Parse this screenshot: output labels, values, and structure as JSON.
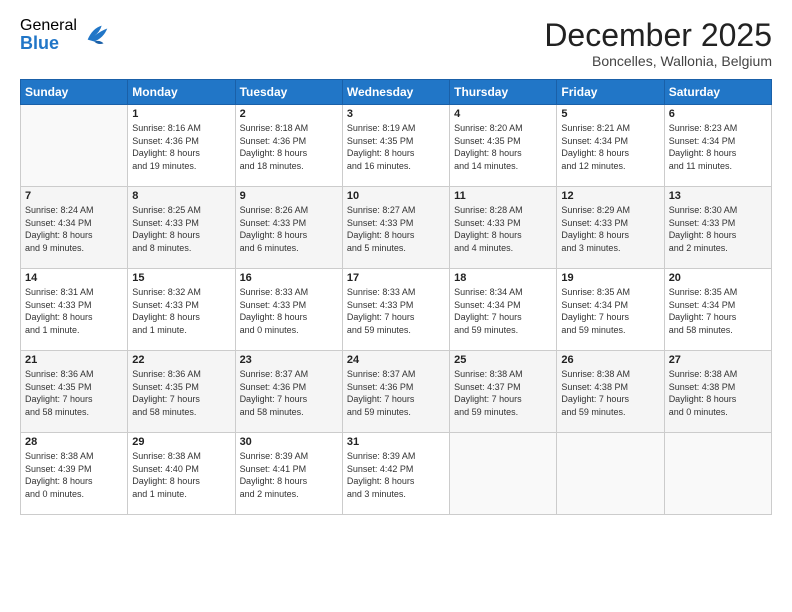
{
  "logo": {
    "general": "General",
    "blue": "Blue"
  },
  "header": {
    "month": "December 2025",
    "location": "Boncelles, Wallonia, Belgium"
  },
  "weekdays": [
    "Sunday",
    "Monday",
    "Tuesday",
    "Wednesday",
    "Thursday",
    "Friday",
    "Saturday"
  ],
  "weeks": [
    [
      {
        "day": "",
        "info": ""
      },
      {
        "day": "1",
        "info": "Sunrise: 8:16 AM\nSunset: 4:36 PM\nDaylight: 8 hours\nand 19 minutes."
      },
      {
        "day": "2",
        "info": "Sunrise: 8:18 AM\nSunset: 4:36 PM\nDaylight: 8 hours\nand 18 minutes."
      },
      {
        "day": "3",
        "info": "Sunrise: 8:19 AM\nSunset: 4:35 PM\nDaylight: 8 hours\nand 16 minutes."
      },
      {
        "day": "4",
        "info": "Sunrise: 8:20 AM\nSunset: 4:35 PM\nDaylight: 8 hours\nand 14 minutes."
      },
      {
        "day": "5",
        "info": "Sunrise: 8:21 AM\nSunset: 4:34 PM\nDaylight: 8 hours\nand 12 minutes."
      },
      {
        "day": "6",
        "info": "Sunrise: 8:23 AM\nSunset: 4:34 PM\nDaylight: 8 hours\nand 11 minutes."
      }
    ],
    [
      {
        "day": "7",
        "info": "Sunrise: 8:24 AM\nSunset: 4:34 PM\nDaylight: 8 hours\nand 9 minutes."
      },
      {
        "day": "8",
        "info": "Sunrise: 8:25 AM\nSunset: 4:33 PM\nDaylight: 8 hours\nand 8 minutes."
      },
      {
        "day": "9",
        "info": "Sunrise: 8:26 AM\nSunset: 4:33 PM\nDaylight: 8 hours\nand 6 minutes."
      },
      {
        "day": "10",
        "info": "Sunrise: 8:27 AM\nSunset: 4:33 PM\nDaylight: 8 hours\nand 5 minutes."
      },
      {
        "day": "11",
        "info": "Sunrise: 8:28 AM\nSunset: 4:33 PM\nDaylight: 8 hours\nand 4 minutes."
      },
      {
        "day": "12",
        "info": "Sunrise: 8:29 AM\nSunset: 4:33 PM\nDaylight: 8 hours\nand 3 minutes."
      },
      {
        "day": "13",
        "info": "Sunrise: 8:30 AM\nSunset: 4:33 PM\nDaylight: 8 hours\nand 2 minutes."
      }
    ],
    [
      {
        "day": "14",
        "info": "Sunrise: 8:31 AM\nSunset: 4:33 PM\nDaylight: 8 hours\nand 1 minute."
      },
      {
        "day": "15",
        "info": "Sunrise: 8:32 AM\nSunset: 4:33 PM\nDaylight: 8 hours\nand 1 minute."
      },
      {
        "day": "16",
        "info": "Sunrise: 8:33 AM\nSunset: 4:33 PM\nDaylight: 8 hours\nand 0 minutes."
      },
      {
        "day": "17",
        "info": "Sunrise: 8:33 AM\nSunset: 4:33 PM\nDaylight: 7 hours\nand 59 minutes."
      },
      {
        "day": "18",
        "info": "Sunrise: 8:34 AM\nSunset: 4:34 PM\nDaylight: 7 hours\nand 59 minutes."
      },
      {
        "day": "19",
        "info": "Sunrise: 8:35 AM\nSunset: 4:34 PM\nDaylight: 7 hours\nand 59 minutes."
      },
      {
        "day": "20",
        "info": "Sunrise: 8:35 AM\nSunset: 4:34 PM\nDaylight: 7 hours\nand 58 minutes."
      }
    ],
    [
      {
        "day": "21",
        "info": "Sunrise: 8:36 AM\nSunset: 4:35 PM\nDaylight: 7 hours\nand 58 minutes."
      },
      {
        "day": "22",
        "info": "Sunrise: 8:36 AM\nSunset: 4:35 PM\nDaylight: 7 hours\nand 58 minutes."
      },
      {
        "day": "23",
        "info": "Sunrise: 8:37 AM\nSunset: 4:36 PM\nDaylight: 7 hours\nand 58 minutes."
      },
      {
        "day": "24",
        "info": "Sunrise: 8:37 AM\nSunset: 4:36 PM\nDaylight: 7 hours\nand 59 minutes."
      },
      {
        "day": "25",
        "info": "Sunrise: 8:38 AM\nSunset: 4:37 PM\nDaylight: 7 hours\nand 59 minutes."
      },
      {
        "day": "26",
        "info": "Sunrise: 8:38 AM\nSunset: 4:38 PM\nDaylight: 7 hours\nand 59 minutes."
      },
      {
        "day": "27",
        "info": "Sunrise: 8:38 AM\nSunset: 4:38 PM\nDaylight: 8 hours\nand 0 minutes."
      }
    ],
    [
      {
        "day": "28",
        "info": "Sunrise: 8:38 AM\nSunset: 4:39 PM\nDaylight: 8 hours\nand 0 minutes."
      },
      {
        "day": "29",
        "info": "Sunrise: 8:38 AM\nSunset: 4:40 PM\nDaylight: 8 hours\nand 1 minute."
      },
      {
        "day": "30",
        "info": "Sunrise: 8:39 AM\nSunset: 4:41 PM\nDaylight: 8 hours\nand 2 minutes."
      },
      {
        "day": "31",
        "info": "Sunrise: 8:39 AM\nSunset: 4:42 PM\nDaylight: 8 hours\nand 3 minutes."
      },
      {
        "day": "",
        "info": ""
      },
      {
        "day": "",
        "info": ""
      },
      {
        "day": "",
        "info": ""
      }
    ]
  ]
}
